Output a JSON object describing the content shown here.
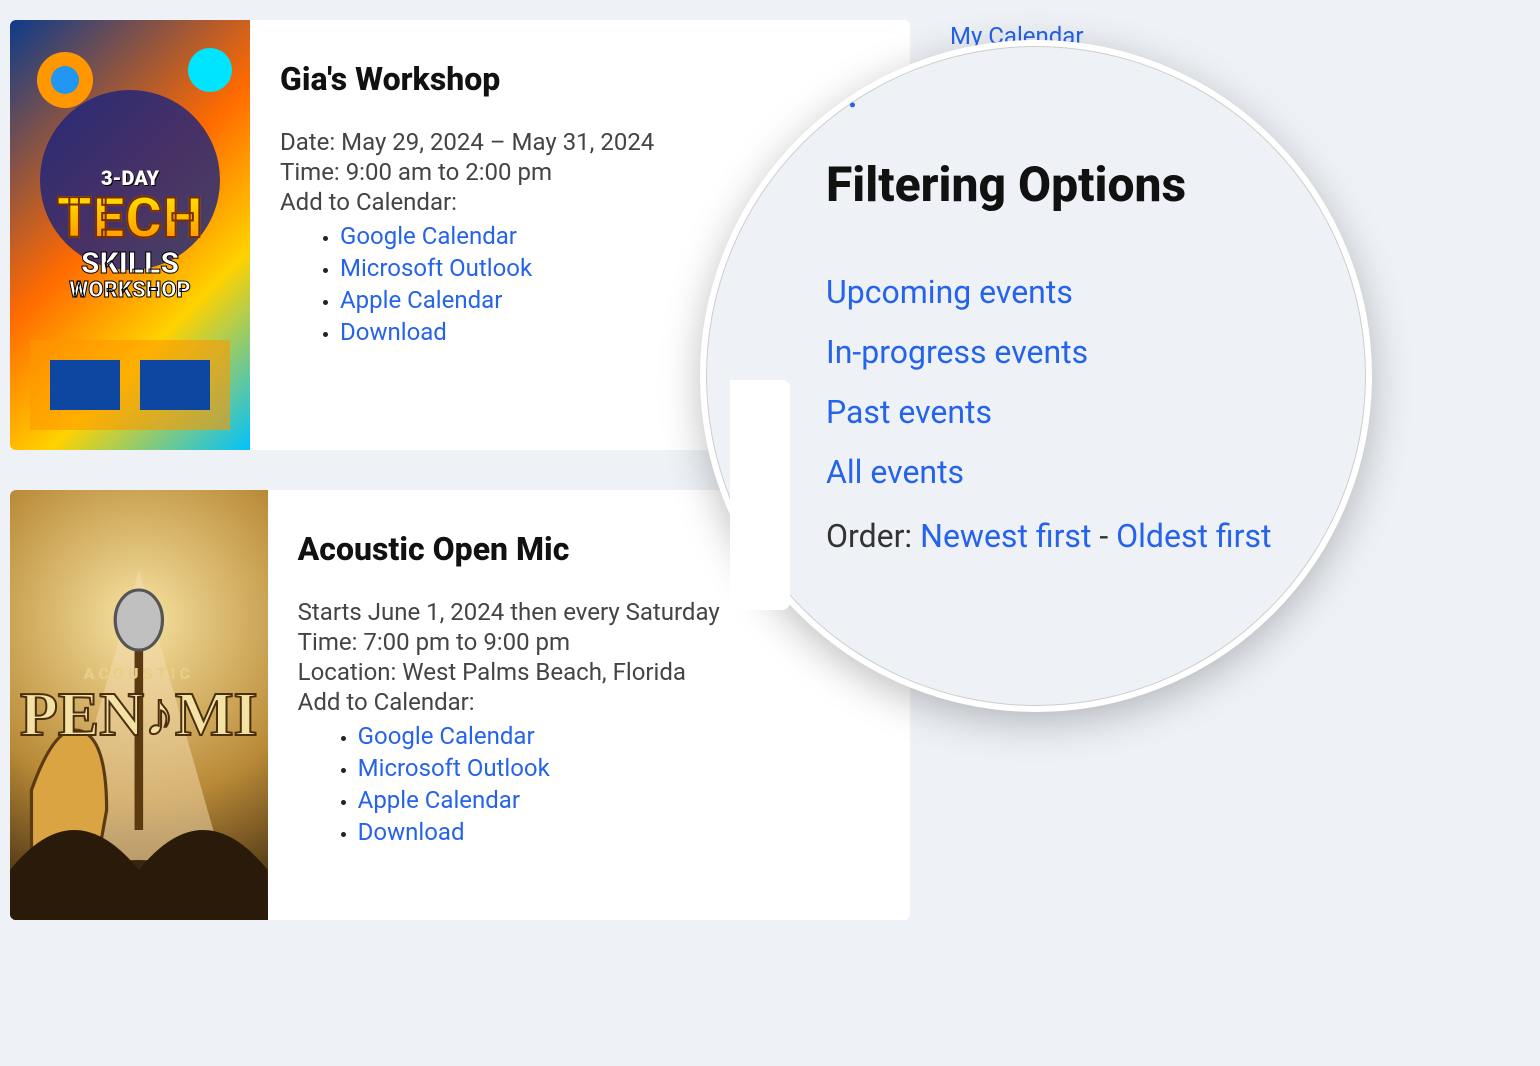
{
  "sidebar": {
    "my_calendar": "My Calendar"
  },
  "events": [
    {
      "title": "Gia's Workshop",
      "date_line": "Date: May 29, 2024 – May 31, 2024",
      "time_line": "Time: 9:00 am to 2:00 pm",
      "add_label": "Add to Calendar:",
      "cal_links": {
        "google": "Google Calendar",
        "outlook": "Microsoft Outlook",
        "apple": "Apple Calendar",
        "download": "Download"
      },
      "poster": {
        "kicker": "3-DAY",
        "big": "TECH",
        "mid": "SKILLS",
        "sub": "WORKSHOP"
      }
    },
    {
      "title": "Acoustic Open Mic",
      "recurrence_line": "Starts June 1, 2024 then every Saturday",
      "time_line": "Time: 7:00 pm to 9:00 pm",
      "location_line": "Location: West Palms Beach, Florida",
      "add_label": "Add to Calendar:",
      "cal_links": {
        "google": "Google Calendar",
        "outlook": "Microsoft Outlook",
        "apple": "Apple Calendar",
        "download": "Download"
      },
      "poster": {
        "kicker": "ACOUSTIC",
        "big": "PEN♪MI"
      }
    }
  ],
  "lens": {
    "partial_top": "··:",
    "heading": "Filtering Options",
    "filters": {
      "upcoming": "Upcoming events",
      "in_progress": "In-progress events",
      "past": "Past events",
      "all": "All events"
    },
    "order_label": "Order: ",
    "order_newest": "Newest first",
    "order_sep": " - ",
    "order_oldest": "Oldest first"
  }
}
